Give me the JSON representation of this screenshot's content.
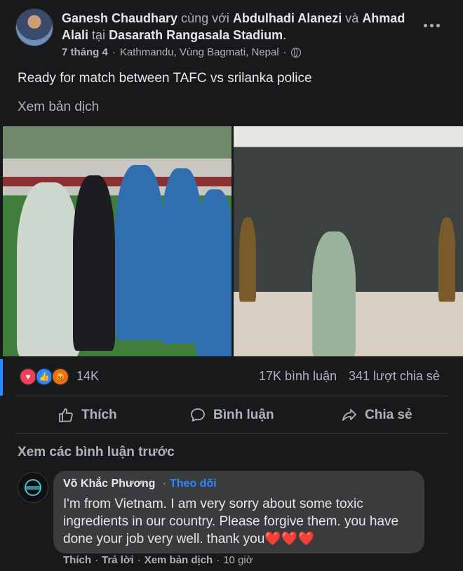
{
  "post": {
    "author": "Ganesh Chaudhary",
    "with_word": "cùng với",
    "tagged_1": "Abdulhadi Alanezi",
    "and_word": "và",
    "tagged_2": "Ahmad Alali",
    "at_word": "tại",
    "place": "Dasarath Rangasala Stadium",
    "period": ".",
    "date": "7 tháng 4",
    "location": "Kathmandu, Vùng Bagmati, Nepal",
    "dot": "·",
    "text": "Ready for match between TAFC vs srilanka police",
    "see_translation": "Xem bản dịch",
    "audience_icon": "globe-icon",
    "more_icon": "more-dots-icon"
  },
  "stats": {
    "reactions": "14K",
    "reaction_icons": [
      "love-reaction-icon",
      "like-reaction-icon",
      "angry-reaction-icon"
    ],
    "comments": "17K bình luận",
    "shares": "341 lượt chia sẻ"
  },
  "actions": {
    "like": "Thích",
    "comment": "Bình luận",
    "share": "Chia sẻ"
  },
  "comments_section": {
    "view_previous": "Xem các bình luận trước",
    "comment": {
      "name": "Võ Khắc Phương",
      "sep": "·",
      "follow": "Theo dõi",
      "body": "I'm from Vietnam. I am very sorry about some toxic ingredients in our country. Please forgive them. you have done your job very well. thank you❤️❤️❤️",
      "like": "Thích",
      "reply": "Trả lời",
      "translate": "Xem bản dịch",
      "time": "10 giờ"
    }
  },
  "colors": {
    "background": "#18191a",
    "bubble": "#3a3b3c",
    "accent": "#2d88ff",
    "muted_text": "#b0b3b8",
    "primary_text": "#e4e6eb"
  }
}
